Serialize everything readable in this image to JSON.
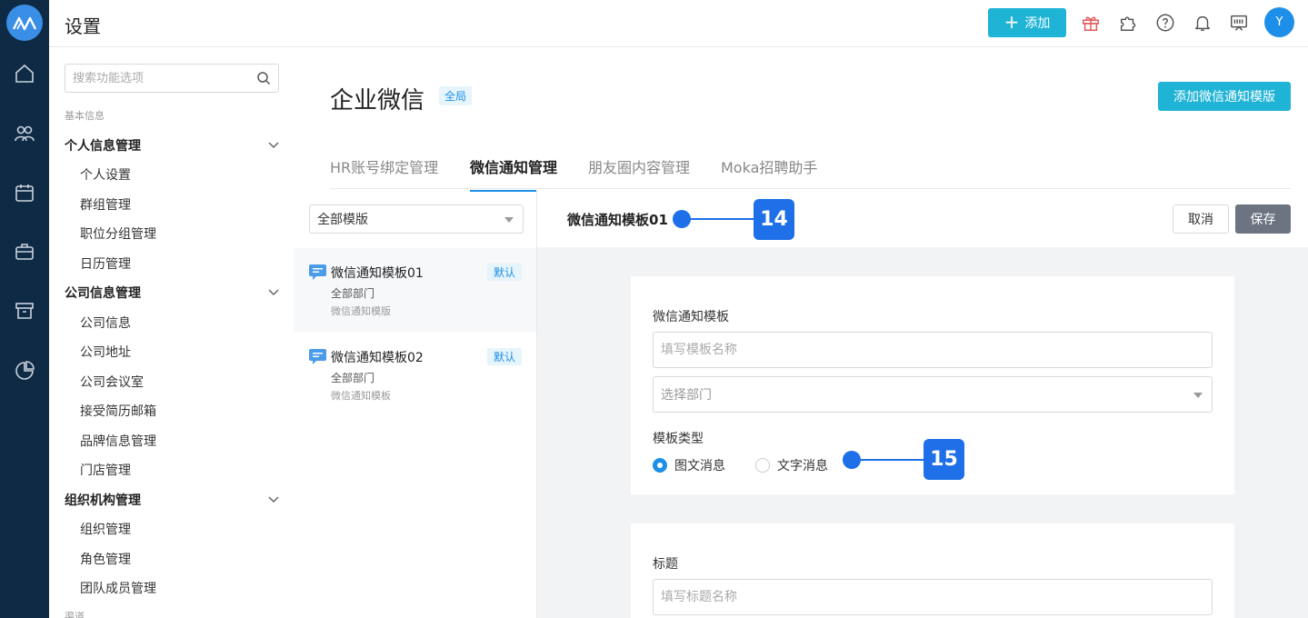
{
  "app": {
    "title": "设置",
    "add_label": "添加",
    "avatar_initial": "Y",
    "accent": "#1fb3d6"
  },
  "rail": {
    "icons": [
      "home-icon",
      "people-icon",
      "calendar-icon",
      "briefcase-icon",
      "archive-icon",
      "pie-chart-icon"
    ]
  },
  "header_icons": [
    "gift-icon",
    "puzzle-icon",
    "help-icon",
    "bell-icon",
    "feedback-icon"
  ],
  "sidebar": {
    "search_placeholder": "搜索功能选项",
    "section_basic": "基本信息",
    "groups": [
      {
        "label": "个人信息管理",
        "items": [
          "个人设置",
          "群组管理",
          "职位分组管理",
          "日历管理"
        ]
      },
      {
        "label": "公司信息管理",
        "items": [
          "公司信息",
          "公司地址",
          "公司会议室",
          "接受简历邮箱",
          "品牌信息管理",
          "门店管理"
        ]
      },
      {
        "label": "组织机构管理",
        "items": [
          "组织管理",
          "角色管理",
          "团队成员管理"
        ]
      }
    ],
    "section_cut": "渠道"
  },
  "main": {
    "page_title": "企业微信",
    "scope_badge": "全局",
    "add_template_button": "添加微信通知模版",
    "tabs": [
      "HR账号绑定管理",
      "微信通知管理",
      "朋友圈内容管理",
      "Moka招聘助手"
    ],
    "active_tab": 1
  },
  "template_list": {
    "filter_value": "全部模版",
    "items": [
      {
        "name": "微信通知模板01",
        "dept": "全部部门",
        "type": "微信通知模版",
        "badge": "默认"
      },
      {
        "name": "微信通知模板02",
        "dept": "全部部门",
        "type": "微信通知模板",
        "badge": "默认"
      }
    ]
  },
  "editor": {
    "title": "微信通知模板01",
    "cancel": "取消",
    "save": "保存",
    "form": {
      "template_label": "微信通知模板",
      "name_placeholder": "填写模板名称",
      "dept_placeholder": "选择部门",
      "type_label": "模板类型",
      "type_options": [
        "图文消息",
        "文字消息"
      ],
      "type_selected": "图文消息",
      "title_label": "标题",
      "title_placeholder": "填写标题名称"
    }
  },
  "annotations": {
    "marker_1": "14",
    "marker_2": "15"
  }
}
